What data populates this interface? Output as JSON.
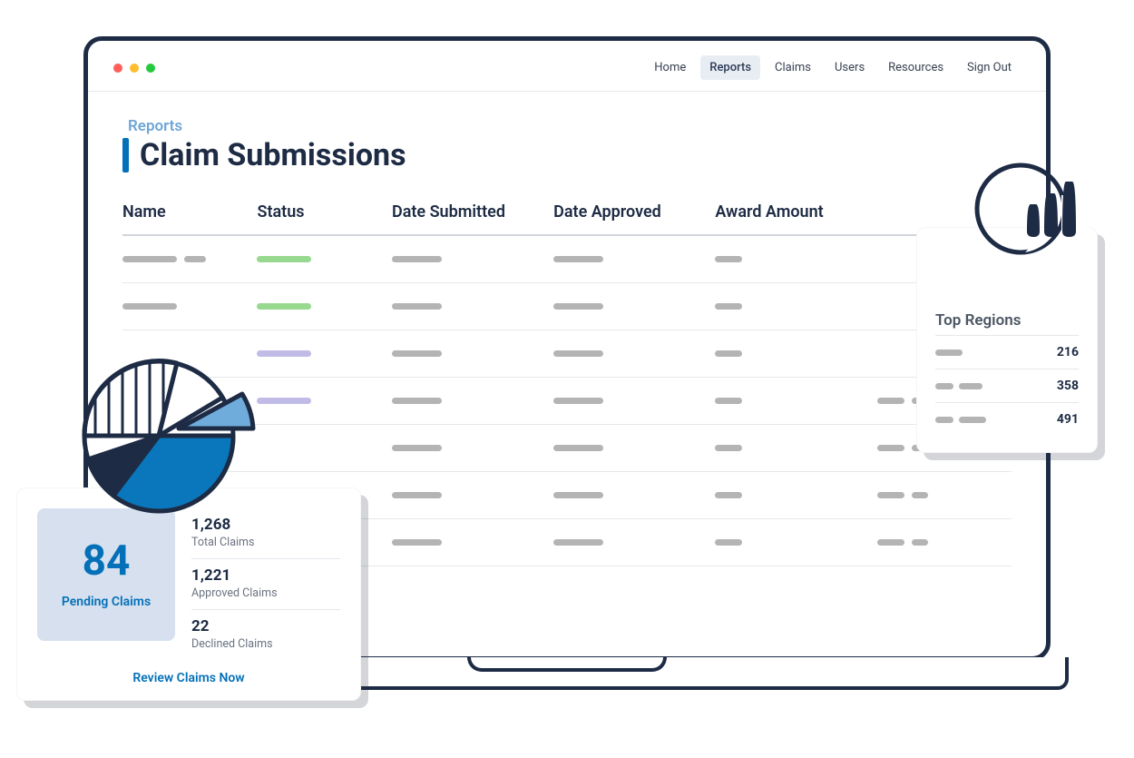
{
  "nav": {
    "items": [
      "Home",
      "Reports",
      "Claims",
      "Users",
      "Resources",
      "Sign Out"
    ],
    "active": "Reports"
  },
  "header": {
    "breadcrumb": "Reports",
    "title": "Claim Submissions"
  },
  "table": {
    "columns": [
      "Name",
      "Status",
      "Date Submitted",
      "Date Approved",
      "Award Amount",
      ""
    ]
  },
  "regions": {
    "title": "Top Regions",
    "rows": [
      {
        "value": "216"
      },
      {
        "value": "358"
      },
      {
        "value": "491"
      }
    ]
  },
  "claims": {
    "pending_value": "84",
    "pending_label": "Pending Claims",
    "stats": [
      {
        "value": "1,268",
        "label": "Total Claims"
      },
      {
        "value": "1,221",
        "label": "Approved Claims"
      },
      {
        "value": "22",
        "label": "Declined Claims"
      }
    ],
    "review_link": "Review Claims Now"
  }
}
